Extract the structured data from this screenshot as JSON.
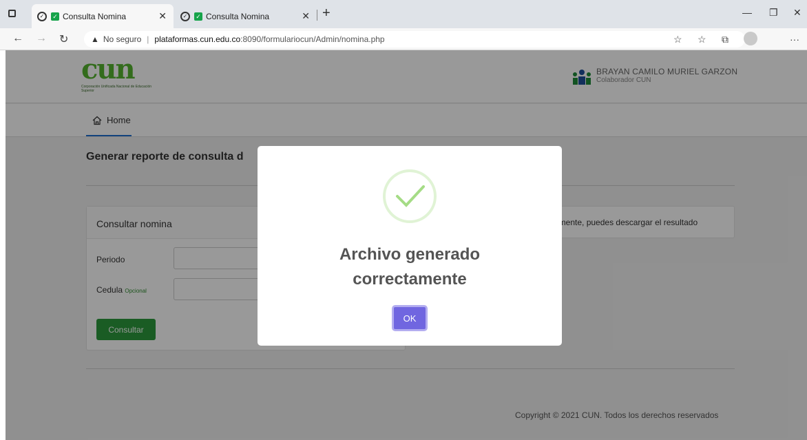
{
  "browser": {
    "tabs": [
      {
        "title": "Consulta Nomina",
        "active": true
      },
      {
        "title": "Consulta Nomina",
        "active": false
      }
    ],
    "new_tab_icon": "+",
    "url": {
      "security": "No seguro",
      "domain": "plataformas.cun.edu.co",
      "path": ":8090/formulariocun/Admin/nomina.php"
    }
  },
  "header": {
    "logo_text": "cun",
    "logo_subtitle": "Corporación Unificada Nacional de Educación Superior",
    "user_name": "BRAYAN CAMILO MURIEL GARZON",
    "user_role": "Colaborador CUN"
  },
  "nav": {
    "home_label": "Home"
  },
  "main": {
    "title": "Generar reporte de consulta d",
    "form": {
      "heading": "Consultar nomina",
      "periodo_label": "Periodo",
      "cedula_label": "Cedula",
      "cedula_optional": "Opcional",
      "periodo_value": "",
      "cedula_value": "",
      "submit_label": "Consultar"
    },
    "result_message": "amente, puedes descargar el resultado"
  },
  "footer": {
    "copyright": "Copyright © 2021 CUN. Todos los derechos reservados"
  },
  "modal": {
    "title_line1": "Archivo generado",
    "title_line2": "correctamente",
    "ok_label": "OK",
    "icon": "success-check-icon"
  },
  "colors": {
    "brand_green": "#55b530",
    "submit_green": "#2c9a3c",
    "ok_purple": "#7066e0",
    "nav_underline": "#1f6fd1"
  }
}
